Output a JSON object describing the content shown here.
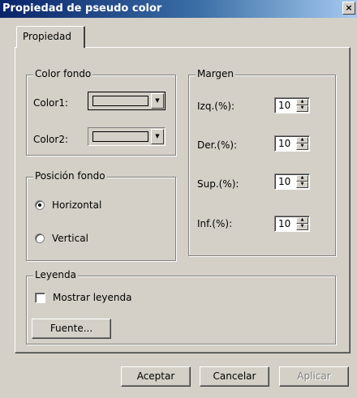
{
  "window": {
    "title": "Propiedad de pseudo color",
    "close_glyph": "×"
  },
  "tabs": [
    {
      "label": "Propiedad",
      "selected": true
    }
  ],
  "color_fondo": {
    "legend": "Color fondo",
    "color1_label": "Color1:",
    "color2_label": "Color2:",
    "color1_value": "#d4d0c8",
    "color2_value": "#d4d0c8"
  },
  "posicion_fondo": {
    "legend": "Posición fondo",
    "options": [
      {
        "label": "Horizontal",
        "checked": true
      },
      {
        "label": "Vertical",
        "checked": false
      }
    ]
  },
  "margen": {
    "legend": "Margen",
    "fields": [
      {
        "label": "Izq.(%):",
        "value": "10"
      },
      {
        "label": "Der.(%):",
        "value": "10"
      },
      {
        "label": "Sup.(%):",
        "value": "10"
      },
      {
        "label": "Inf.(%):",
        "value": "10"
      }
    ]
  },
  "leyenda": {
    "legend": "Leyenda",
    "show_label": "Mostrar leyenda",
    "show_checked": false,
    "font_button": "Fuente..."
  },
  "buttons": {
    "accept": "Aceptar",
    "cancel": "Cancelar",
    "apply": "Aplicar"
  },
  "colors": {
    "titlebar_start": "#0a246a",
    "titlebar_end": "#a6caf0",
    "face": "#d4d0c8"
  }
}
